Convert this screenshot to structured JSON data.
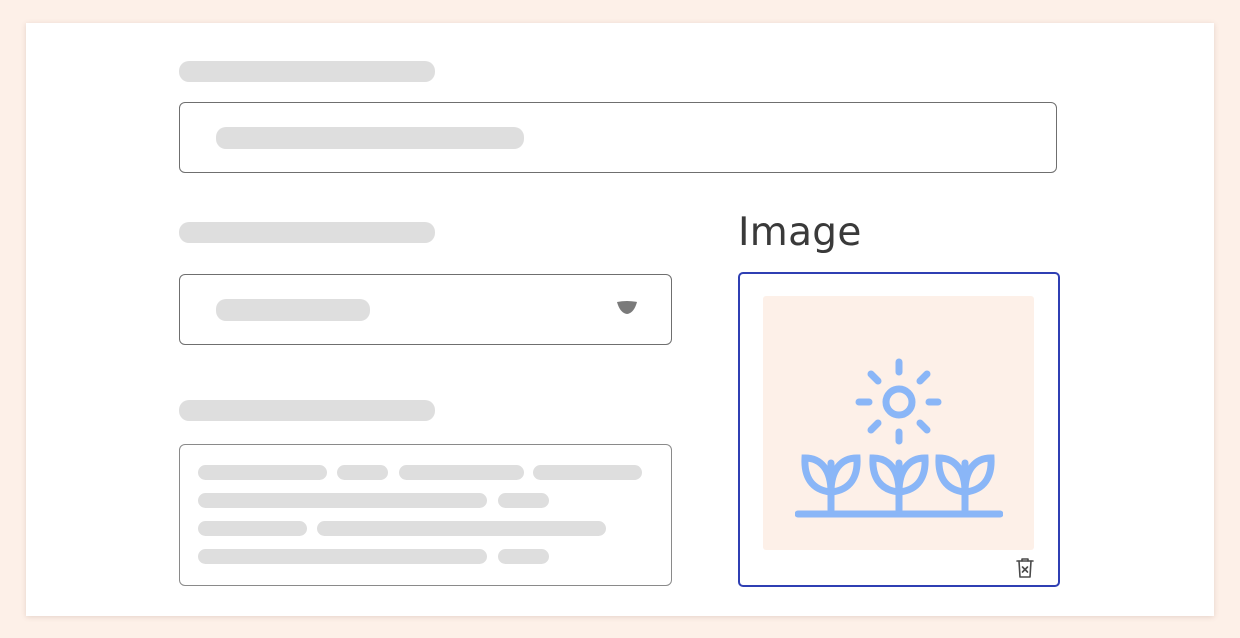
{
  "image_field": {
    "label": "Image",
    "thumbnail_icon": "sun-and-plants-icon",
    "delete_icon": "trash-delete-icon",
    "accent_border_color": "#2f3fb3",
    "icon_color": "#8ab6f7",
    "thumbnail_background": "#fdf0e8"
  },
  "placeholders": {
    "skeleton_color": "#dedede",
    "dropdown_icon": "chevron-down-icon"
  },
  "colors": {
    "page_background": "#fdf0e8",
    "card_background": "#ffffff"
  }
}
